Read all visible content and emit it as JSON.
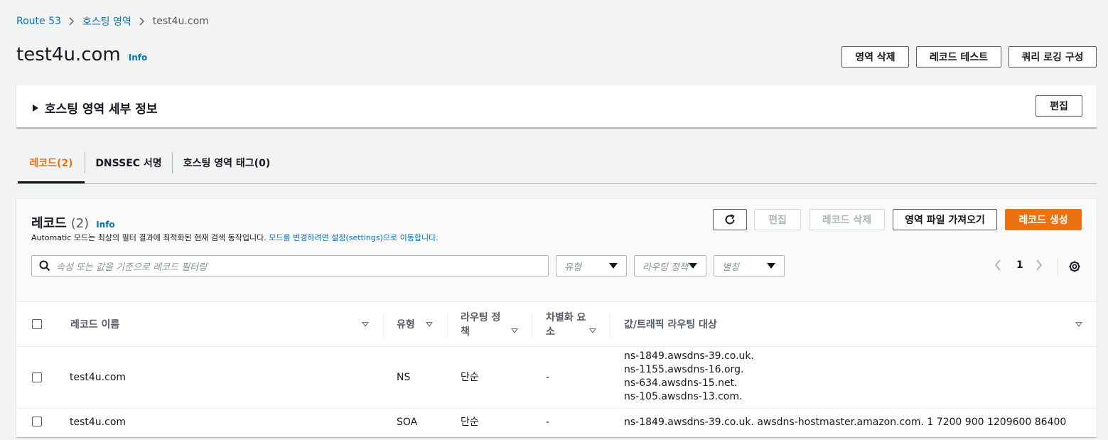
{
  "breadcrumb": {
    "items": [
      "Route 53",
      "호스팅 영역"
    ],
    "current": "test4u.com"
  },
  "header": {
    "title": "test4u.com",
    "info": "Info",
    "buttons": {
      "delete_zone": "영역 삭제",
      "test_record": "레코드 테스트",
      "query_logging": "쿼리 로깅 구성"
    }
  },
  "details": {
    "title": "호스팅 영역 세부 정보",
    "edit": "편집"
  },
  "tabs": [
    {
      "label": "레코드(2)",
      "active": true
    },
    {
      "label": "DNSSEC 서명",
      "active": false
    },
    {
      "label": "호스팅 영역 태그(0)",
      "active": false
    }
  ],
  "records": {
    "title": "레코드",
    "count": "(2)",
    "info": "Info",
    "description_prefix": "Automatic 모드는 최상의 필터 결과에 최적화된 현재 검색 동작입니다. ",
    "description_link": "모드를 변경하려면 설정(settings)으로 이동합니다.",
    "buttons": {
      "edit": "편집",
      "delete": "레코드 삭제",
      "import": "영역 파일 가져오기",
      "create": "레코드 생성"
    },
    "search_placeholder": "속성 또는 값을 기준으로 레코드 필터링",
    "filters": {
      "type": "유형",
      "routing": "라우팅 정책",
      "alias": "별칭"
    },
    "page": "1",
    "columns": {
      "name": "레코드 이름",
      "type": "유형",
      "routing_line1": "라우팅 정",
      "routing_line2": "책",
      "diff_line1": "차별화 요",
      "diff_line2": "소",
      "value": "값/트래픽 라우팅 대상"
    },
    "rows": [
      {
        "name": "test4u.com",
        "type": "NS",
        "routing": "단순",
        "diff": "-",
        "values": [
          "ns-1849.awsdns-39.co.uk.",
          "ns-1155.awsdns-16.org.",
          "ns-634.awsdns-15.net.",
          "ns-105.awsdns-13.com."
        ]
      },
      {
        "name": "test4u.com",
        "type": "SOA",
        "routing": "단순",
        "diff": "-",
        "values": [
          "ns-1849.awsdns-39.co.uk. awsdns-hostmaster.amazon.com. 1 7200 900 1209600 86400"
        ]
      }
    ]
  },
  "colors": {
    "link": "#0073bb",
    "accent": "#ec7211",
    "background": "#f2f3f3"
  }
}
